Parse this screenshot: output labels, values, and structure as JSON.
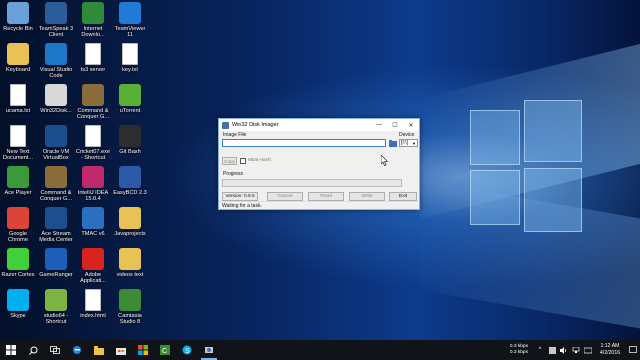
{
  "desktop": {
    "icons": [
      {
        "label": "Recycle Bin",
        "icon": "recycle-bin-icon",
        "color": "#6aa0d8"
      },
      {
        "label": "TeamSpeak 3\nClient",
        "icon": "teamspeak-icon",
        "color": "#2a5d9a"
      },
      {
        "label": "Internet\nDownlo...",
        "icon": "idm-icon",
        "color": "#2e8b3a"
      },
      {
        "label": "TeamViewer\n11",
        "icon": "teamviewer-icon",
        "color": "#1f7ad8"
      },
      {
        "label": "Keyboard",
        "icon": "folder-icon",
        "color": "#e8c255"
      },
      {
        "label": "Visual Studio\nCode",
        "icon": "vscode-icon",
        "color": "#1d76c6"
      },
      {
        "label": "ts3 server",
        "icon": "text-file-icon",
        "color": "#ffffff"
      },
      {
        "label": "key.txt",
        "icon": "text-file-icon",
        "color": "#ffffff"
      },
      {
        "label": "ucama.txt",
        "icon": "text-file-icon",
        "color": "#ffffff"
      },
      {
        "label": "Win32Disk...",
        "icon": "win32-disk-imager-icon",
        "color": "#d8d8d8"
      },
      {
        "label": "Command &\nConquer G...",
        "icon": "cnc-icon",
        "color": "#8a6d3b"
      },
      {
        "label": "uTorrent",
        "icon": "utorrent-icon",
        "color": "#5ab034"
      },
      {
        "label": "New Text\nDocument...",
        "icon": "text-file-icon",
        "color": "#ffffff"
      },
      {
        "label": "Oracle VM\nVirtualBox",
        "icon": "virtualbox-icon",
        "color": "#1b4f8c"
      },
      {
        "label": "Cricket07.exe\n- Shortcut",
        "icon": "exe-file-icon",
        "color": "#ffffff"
      },
      {
        "label": "Git Bash",
        "icon": "git-bash-icon",
        "color": "#2d2d2d"
      },
      {
        "label": "Ace Player",
        "icon": "ace-player-icon",
        "color": "#3a9a3a"
      },
      {
        "label": "Command &\nConquer G...",
        "icon": "cnc-icon",
        "color": "#8a6d3b"
      },
      {
        "label": "IntelliJ IDEA\n15.0.4",
        "icon": "intellij-icon",
        "color": "#c02a6a"
      },
      {
        "label": "EasyBCD 2.3",
        "icon": "easybcd-icon",
        "color": "#2c5aa8"
      },
      {
        "label": "Google\nChrome",
        "icon": "chrome-icon",
        "color": "#db4437"
      },
      {
        "label": "Ace Stream\nMedia Center",
        "icon": "ace-stream-icon",
        "color": "#1d4f8c"
      },
      {
        "label": "TMAC v6",
        "icon": "tmac-icon",
        "color": "#2a6fc0"
      },
      {
        "label": "Javaprojects",
        "icon": "folder-icon",
        "color": "#e8c255"
      },
      {
        "label": "Razer Cortex",
        "icon": "razer-icon",
        "color": "#3fd03a"
      },
      {
        "label": "GameRanger",
        "icon": "gameranger-icon",
        "color": "#1d5fb8"
      },
      {
        "label": "Adobe\nApplicati...",
        "icon": "adobe-icon",
        "color": "#d8241c"
      },
      {
        "label": "videos text",
        "icon": "folder-icon",
        "color": "#e8c255"
      },
      {
        "label": "Skype",
        "icon": "skype-icon",
        "color": "#00aff0"
      },
      {
        "label": "studio64 -\nShortcut",
        "icon": "android-studio-icon",
        "color": "#7cb342"
      },
      {
        "label": "index.html",
        "icon": "edge-file-icon",
        "color": "#ffffff"
      },
      {
        "label": "Camtasia\nStudio 8",
        "icon": "camtasia-icon",
        "color": "#3d8b37"
      }
    ]
  },
  "dialog": {
    "title": "Win32 Disk Imager",
    "minimize_glyph": "—",
    "maximize_glyph": "☐",
    "close_glyph": "✕",
    "image_file_label": "Image File",
    "image_file_value": "",
    "device_label": "Device",
    "device_value": "[I:\\]",
    "copy_label": "Copy",
    "md5_label": "MD5 Hash:",
    "progress_label": "Progress",
    "progress_value": 0,
    "version_label": "Version: 0.9.5",
    "cancel_label": "Cancel",
    "read_label": "Read",
    "write_label": "Write",
    "exit_label": "Exit",
    "status": "Waiting for a task."
  },
  "taskbar": {
    "net_up": "0.3 kbps",
    "net_down": "0.3 kbps",
    "time": "1:12 AM",
    "date": "4/2/2016"
  }
}
